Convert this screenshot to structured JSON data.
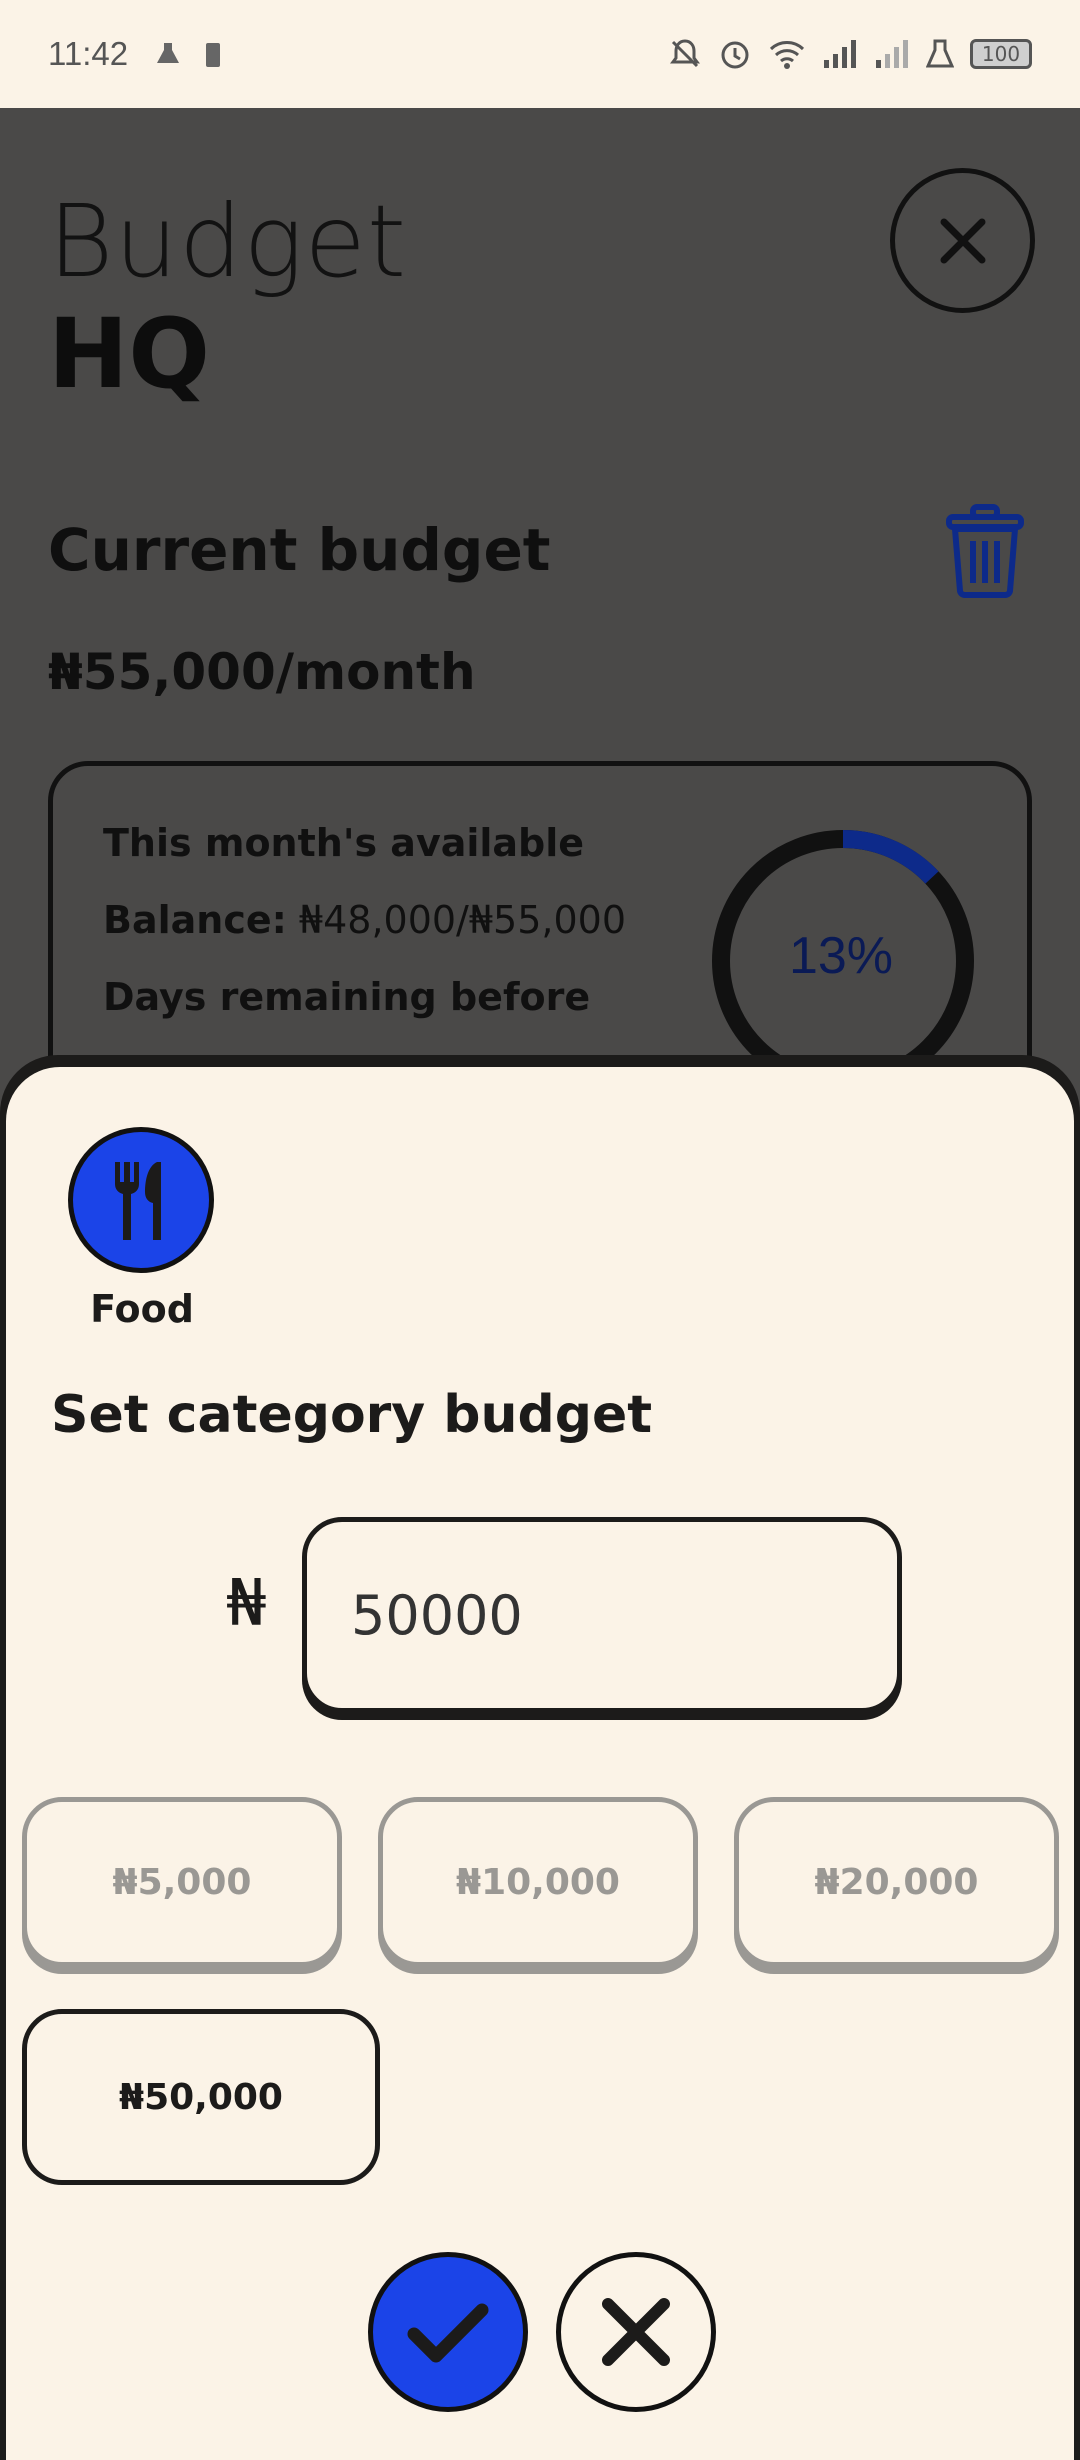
{
  "status_bar": {
    "time": "11:42",
    "battery": "100"
  },
  "background": {
    "title_light": "Budget",
    "title_bold": "HQ",
    "section_title": "Current budget",
    "budget_amount": "₦55,000/month",
    "card": {
      "available_label": "This month's available",
      "balance_label": "Balance:",
      "balance_value": "₦48,000/₦55,000",
      "days_label": "Days remaining before",
      "percent": "13%",
      "percent_value": 0.13
    },
    "accent_color": "#1b44e8"
  },
  "sheet": {
    "category_icon": "fork-knife-icon",
    "category_label": "Food",
    "title": "Set category budget",
    "currency_symbol": "₦",
    "amount_value": "50000",
    "presets": [
      "₦5,000",
      "₦10,000",
      "₦20,000",
      "₦50,000"
    ],
    "selected_preset": "₦50,000",
    "confirm_icon": "checkmark-icon",
    "cancel_icon": "close-icon"
  }
}
